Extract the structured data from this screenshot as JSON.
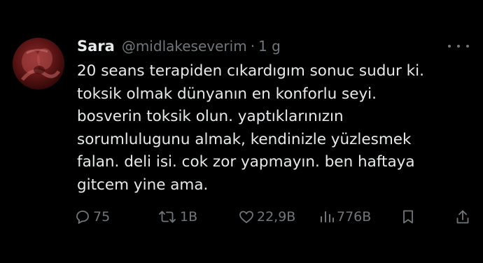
{
  "tweet": {
    "display_name": "Sara",
    "handle": "@midlakeseverim",
    "separator": "·",
    "time": "1 g",
    "text_lines": [
      "20 seans terapiden cıkardıgım sonuc sudur ki.",
      "toksik olmak dünyanın en konforlu seyi.",
      "bosverin toksik olun. yaptıklarınızın",
      "sorumlulugunu almak, kendinizle yüzlesmek",
      "falan. deli isi. cok zor yapmayın. ben haftaya",
      "gitcem yine ama."
    ]
  },
  "actions": {
    "reply": {
      "icon": "reply-icon",
      "count": "75"
    },
    "retweet": {
      "icon": "retweet-icon",
      "count": "1B"
    },
    "like": {
      "icon": "heart-icon",
      "count": "22,9B"
    },
    "views": {
      "icon": "views-icon",
      "count": "776B"
    },
    "bookmark": {
      "icon": "bookmark-icon"
    },
    "share": {
      "icon": "share-icon"
    }
  },
  "colors": {
    "background": "#000000",
    "text_primary": "#e7e9ea",
    "text_secondary": "#71767b"
  }
}
